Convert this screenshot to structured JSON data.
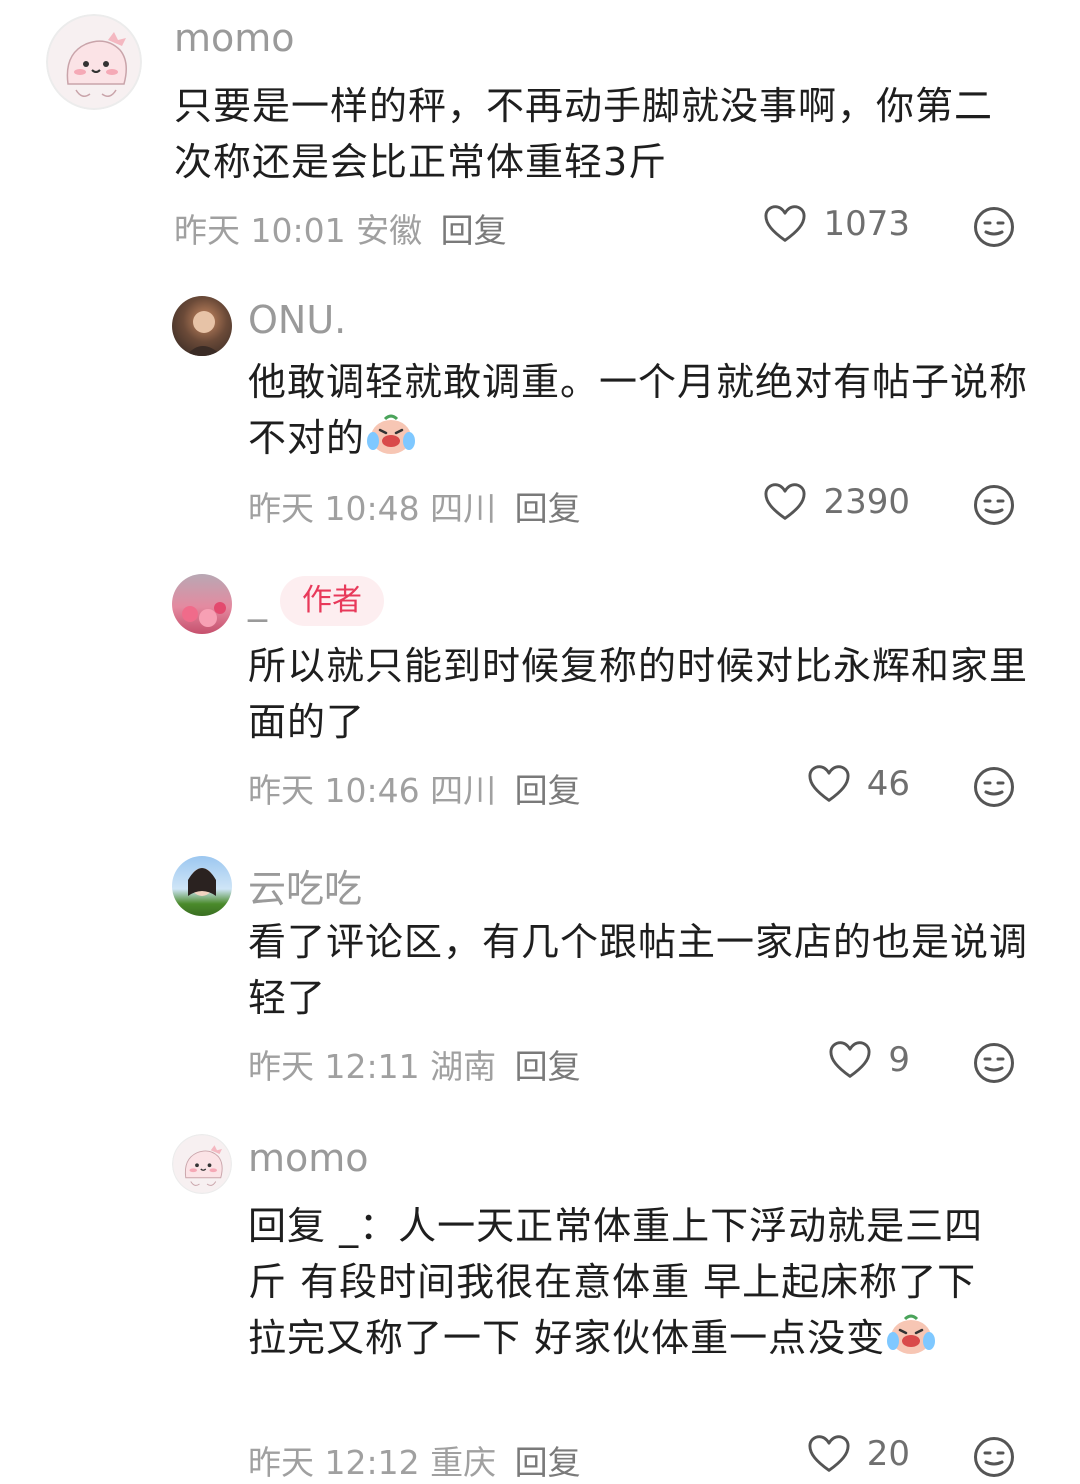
{
  "comments": [
    {
      "user": "momo",
      "text": "只要是一样的秤，不再动手脚就没事啊，你第二次称还是会比正常体重轻3斤",
      "time_loc": "昨天 10:01 安徽",
      "reply": "回复",
      "likes": "1073"
    },
    {
      "user": "ONU.",
      "text": "他敢调轻就敢调重。一个月就绝对有帖子说称不对的",
      "time_loc": "昨天 10:48 四川",
      "reply": "回复",
      "likes": "2390"
    },
    {
      "user": "_",
      "badge": "作者",
      "text": "所以就只能到时候复称的时候对比永辉和家里面的了",
      "time_loc": "昨天 10:46 四川",
      "reply": "回复",
      "likes": "46"
    },
    {
      "user": "云吃吃",
      "text": "看了评论区，有几个跟帖主一家店的也是说调轻了",
      "time_loc": "昨天 12:11 湖南",
      "reply": "回复",
      "likes": "9"
    },
    {
      "user": "momo",
      "text": "回复 _：人一天正常体重上下浮动就是三四斤  有段时间我很在意体重 早上起床称了下  拉完又称了一下 好家伙体重一点没变",
      "time_loc": "昨天 12:12 重庆",
      "reply": "回复",
      "likes": "20"
    }
  ],
  "icons": {
    "like": "heart-outline-icon",
    "react": "neutral-face-icon",
    "emoji": "crying-laughing-emoji"
  },
  "colors": {
    "author_badge_bg": "#fdeef0",
    "author_badge_text": "#e8395a",
    "meta": "#a0a0a0"
  }
}
